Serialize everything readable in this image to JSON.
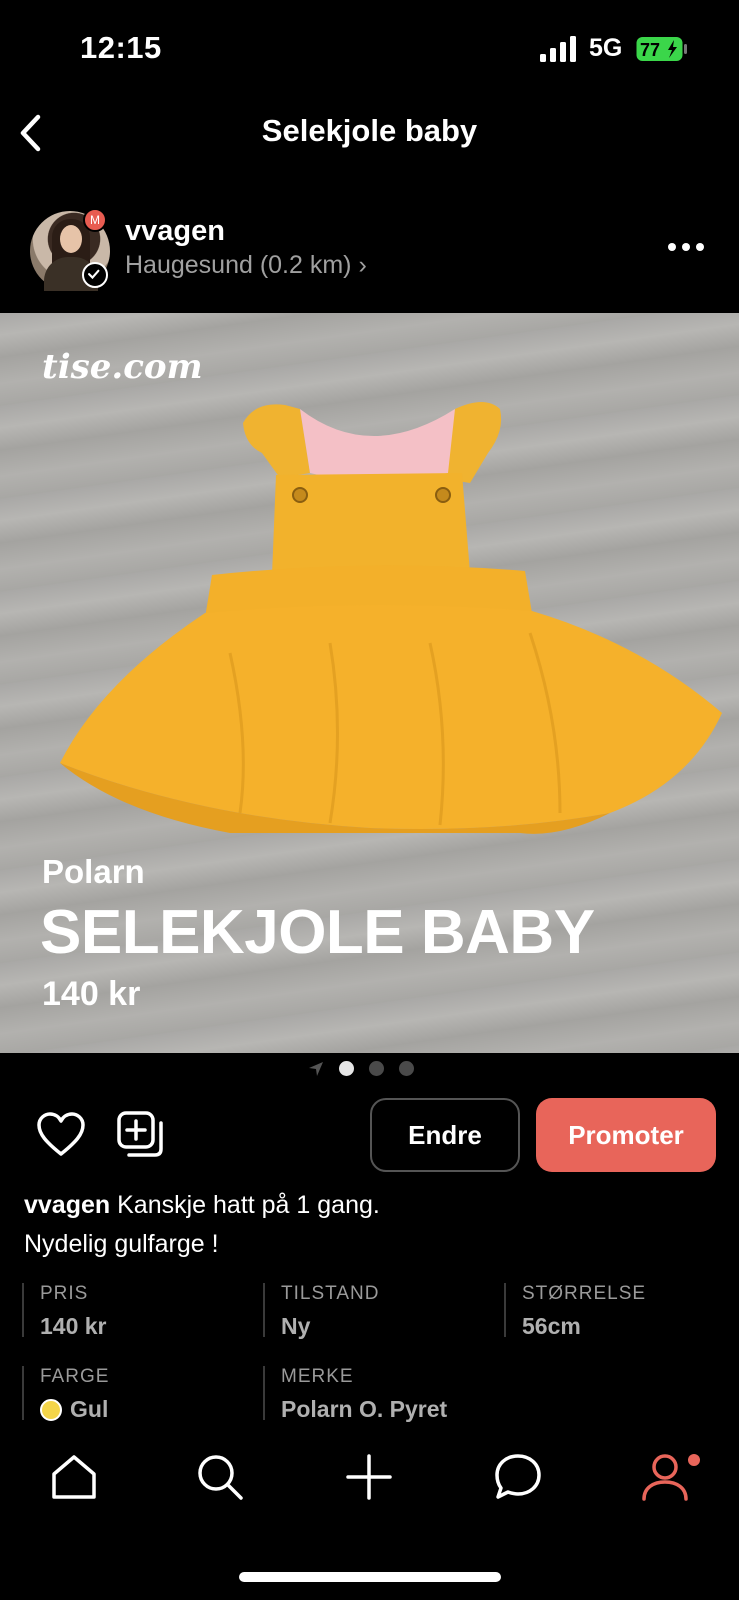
{
  "status_bar": {
    "time": "12:15",
    "network": "5G",
    "battery": "77"
  },
  "nav": {
    "title": "Selekjole baby"
  },
  "seller": {
    "avatar_badge": "M",
    "username": "vvagen",
    "location": "Haugesund (0.2 km) ›"
  },
  "photo": {
    "watermark": "tise.com",
    "overlay_brand": "Polarn",
    "overlay_title": "SELEKJOLE BABY",
    "overlay_price": "140 kr"
  },
  "carousel": {
    "page_count": 3,
    "active_index": 0
  },
  "actions": {
    "edit_label": "Endre",
    "promote_label": "Promoter"
  },
  "description": {
    "username": "vvagen",
    "text_line1": "Kanskje hatt på 1 gang.",
    "text_line2": "Nydelig gulfarge !"
  },
  "details": [
    {
      "label": "PRIS",
      "value": "140 kr"
    },
    {
      "label": "TILSTAND",
      "value": "Ny"
    },
    {
      "label": "STØRRELSE",
      "value": "56cm"
    },
    {
      "label": "FARGE",
      "value": "Gul"
    },
    {
      "label": "MERKE",
      "value": "Polarn O. Pyret"
    }
  ],
  "colors": {
    "accent": "#e8655a",
    "color_swatch": "#f4d54a",
    "background": "#000000"
  },
  "tabbar": {
    "icons": [
      "home-icon",
      "search-icon",
      "plus-icon",
      "chat-icon",
      "profile-icon"
    ],
    "active": "profile-icon"
  }
}
